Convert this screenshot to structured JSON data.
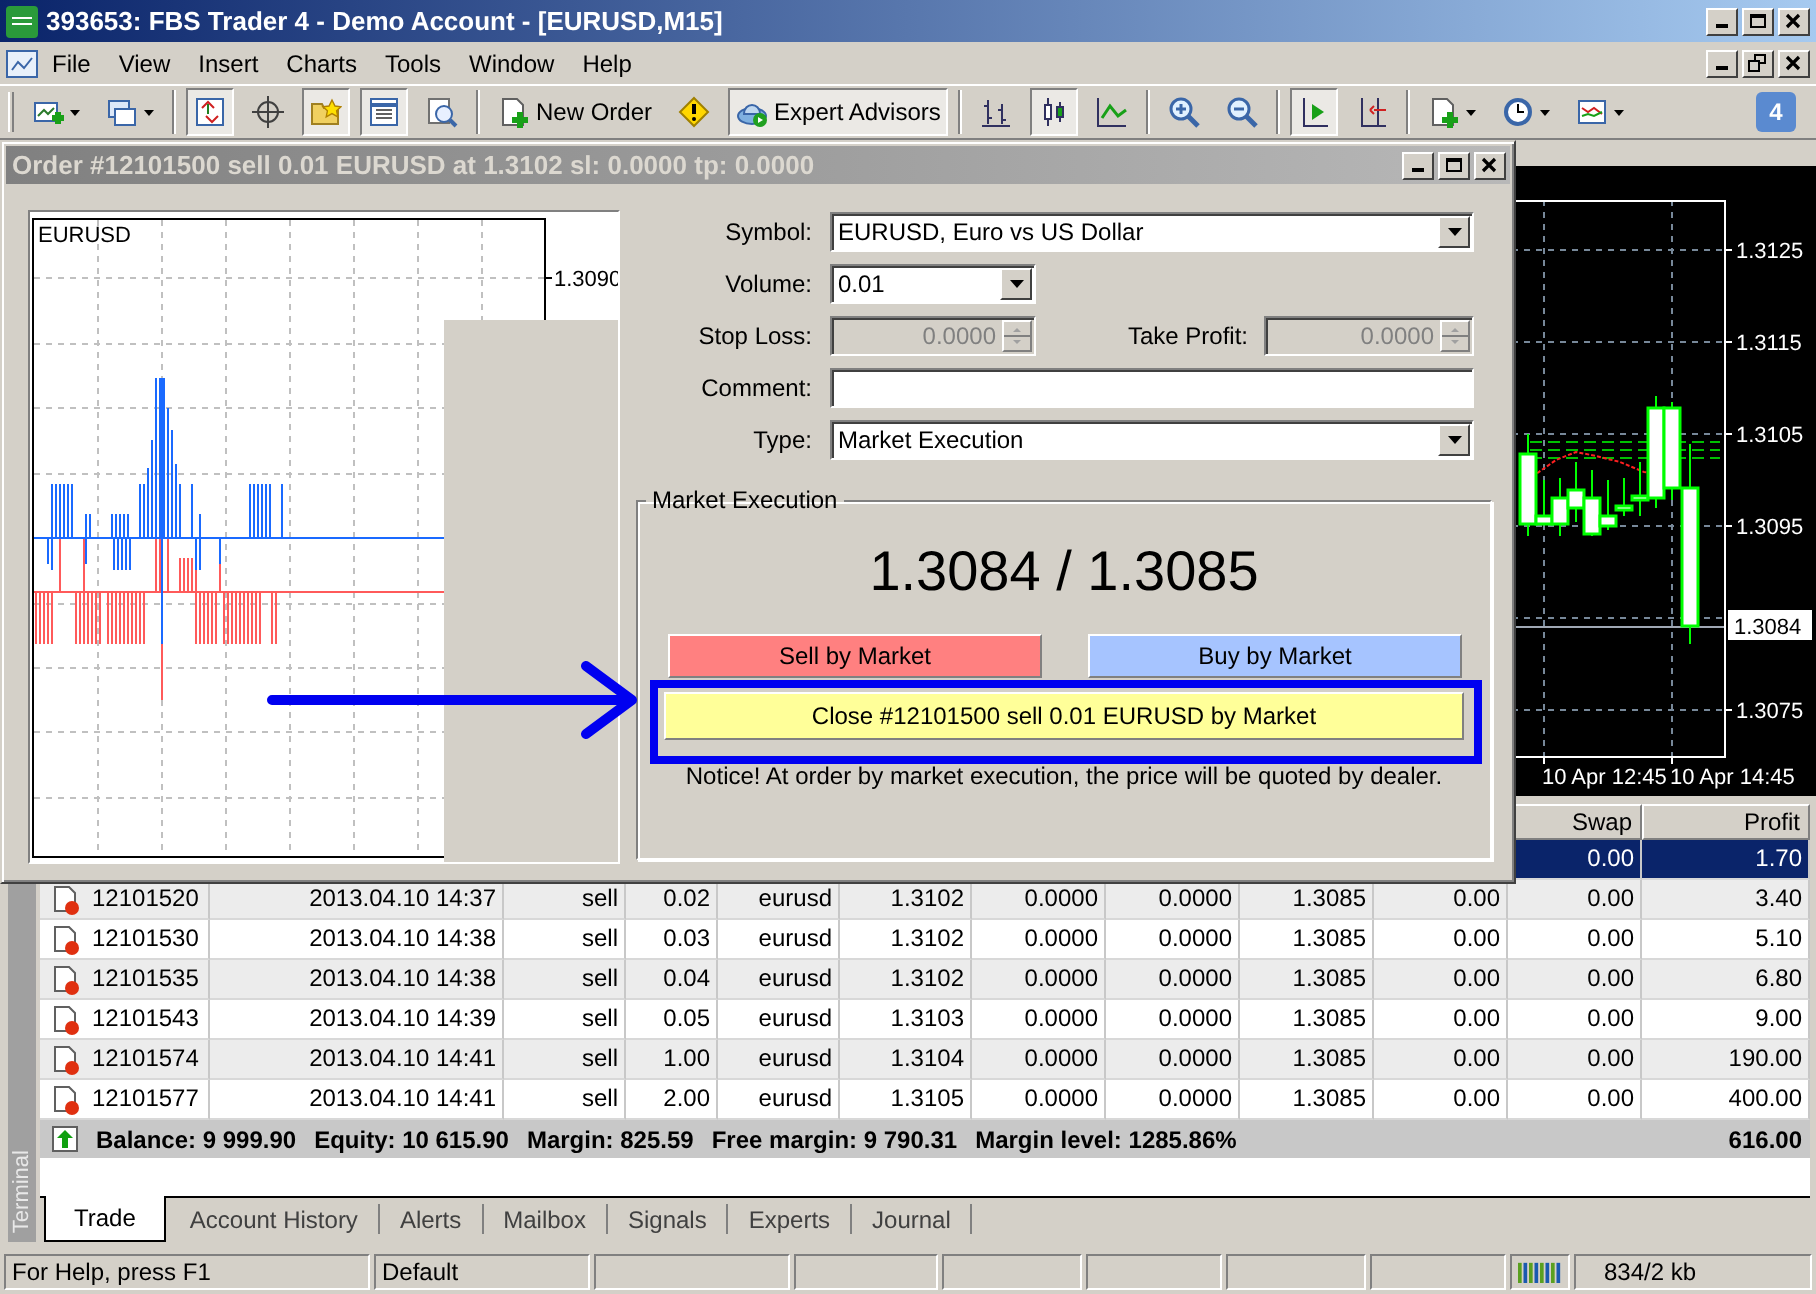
{
  "window": {
    "title": "393653: FBS Trader 4 - Demo Account - [EURUSD,M15]"
  },
  "menu": [
    "File",
    "View",
    "Insert",
    "Charts",
    "Tools",
    "Window",
    "Help"
  ],
  "toolbar": [
    [
      {
        "pressed": false,
        "dropdown": true
      },
      {
        "pressed": false,
        "dropdown": true
      }
    ],
    [
      {
        "pressed": true,
        "dropdown": false
      },
      {
        "pressed": false,
        "dropdown": false
      },
      {
        "pressed": true,
        "dropdown": false
      },
      {
        "pressed": true,
        "dropdown": false
      },
      {
        "pressed": false,
        "dropdown": false
      }
    ],
    [
      {
        "label": "New Order",
        "pressed": false,
        "dropdown": false
      },
      {
        "pressed": false,
        "dropdown": false
      },
      {
        "label": "Expert Advisors",
        "pressed": true,
        "dropdown": false
      }
    ],
    [
      {
        "pressed": false,
        "dropdown": false
      },
      {
        "pressed": true,
        "dropdown": false
      },
      {
        "pressed": false,
        "dropdown": false
      }
    ],
    [
      {
        "pressed": false,
        "dropdown": false
      },
      {
        "pressed": false,
        "dropdown": false
      }
    ],
    [
      {
        "pressed": true,
        "dropdown": false
      },
      {
        "pressed": false,
        "dropdown": false
      }
    ],
    [
      {
        "pressed": false,
        "dropdown": true
      },
      {
        "pressed": false,
        "dropdown": true
      },
      {
        "pressed": false,
        "dropdown": true
      }
    ]
  ],
  "notifications": {
    "count": "4"
  },
  "chart": {
    "price_ticks": [
      "1.3125",
      "1.3115",
      "1.3105",
      "1.3095",
      "1.3075"
    ],
    "current_price": "1.3084",
    "time_labels": [
      "10 Apr 12:45",
      "10 Apr 14:45"
    ]
  },
  "order_dialog": {
    "title": "Order #12101500 sell 0.01 EURUSD at 1.3102 sl: 0.0000 tp: 0.0000",
    "chart": {
      "symbol": "EURUSD",
      "price_tick": "1.3090"
    },
    "symbol": {
      "label": "Symbol:",
      "value": "EURUSD, Euro vs US Dollar"
    },
    "volume": {
      "label": "Volume:",
      "value": "0.01"
    },
    "stop_loss": {
      "label": "Stop Loss:",
      "value": "0.0000",
      "disabled": true
    },
    "take_profit": {
      "label": "Take Profit:",
      "value": "0.0000",
      "disabled": true
    },
    "comment": {
      "label": "Comment:"
    },
    "type": {
      "label": "Type:",
      "value": "Market Execution"
    },
    "execution": {
      "title": "Market Execution",
      "quote": "1.3084 / 1.3085",
      "buttons": [
        {
          "kind": "sell",
          "label": "Sell by Market"
        },
        {
          "kind": "buy",
          "label": "Buy by Market"
        },
        {
          "kind": "close",
          "label": "Close #12101500 sell 0.01 EURUSD by Market"
        }
      ],
      "notice": "Notice! At order by market execution, the price will be quoted by dealer."
    }
  },
  "terminal": {
    "label": "Terminal",
    "columns": [
      "Swap",
      "Profit"
    ],
    "rows": [
      {
        "selected": true,
        "cells": [
          "0.00",
          "1.70"
        ]
      },
      {
        "selected": false,
        "cells": [
          "12101520",
          "2013.04.10 14:37",
          "sell",
          "0.02",
          "eurusd",
          "1.3102",
          "0.0000",
          "0.0000",
          "1.3085",
          "0.00",
          "0.00",
          "3.40"
        ]
      },
      {
        "selected": false,
        "cells": [
          "12101530",
          "2013.04.10 14:38",
          "sell",
          "0.03",
          "eurusd",
          "1.3102",
          "0.0000",
          "0.0000",
          "1.3085",
          "0.00",
          "0.00",
          "5.10"
        ]
      },
      {
        "selected": false,
        "cells": [
          "12101535",
          "2013.04.10 14:38",
          "sell",
          "0.04",
          "eurusd",
          "1.3102",
          "0.0000",
          "0.0000",
          "1.3085",
          "0.00",
          "0.00",
          "6.80"
        ]
      },
      {
        "selected": false,
        "cells": [
          "12101543",
          "2013.04.10 14:39",
          "sell",
          "0.05",
          "eurusd",
          "1.3103",
          "0.0000",
          "0.0000",
          "1.3085",
          "0.00",
          "0.00",
          "9.00"
        ]
      },
      {
        "selected": false,
        "cells": [
          "12101574",
          "2013.04.10 14:41",
          "sell",
          "1.00",
          "eurusd",
          "1.3104",
          "0.0000",
          "0.0000",
          "1.3085",
          "0.00",
          "0.00",
          "190.00"
        ]
      },
      {
        "selected": false,
        "cells": [
          "12101577",
          "2013.04.10 14:41",
          "sell",
          "2.00",
          "eurusd",
          "1.3105",
          "0.0000",
          "0.0000",
          "1.3085",
          "0.00",
          "0.00",
          "400.00"
        ]
      }
    ],
    "balance": {
      "items": [
        "Balance: 9 999.90",
        "Equity: 10 615.90",
        "Margin: 825.59",
        "Free margin: 9 790.31",
        "Margin level: 1285.86%"
      ],
      "profit": "616.00"
    },
    "tabs": [
      {
        "label": "Trade",
        "selected": true
      },
      {
        "label": "Account History",
        "selected": false
      },
      {
        "label": "Alerts",
        "selected": false
      },
      {
        "label": "Mailbox",
        "selected": false
      },
      {
        "label": "Signals",
        "selected": false
      },
      {
        "label": "Experts",
        "selected": false
      },
      {
        "label": "Journal",
        "selected": false
      }
    ]
  },
  "status_bar": {
    "help": "For Help, press F1",
    "profile": "Default",
    "traffic": "834/2 kb"
  }
}
